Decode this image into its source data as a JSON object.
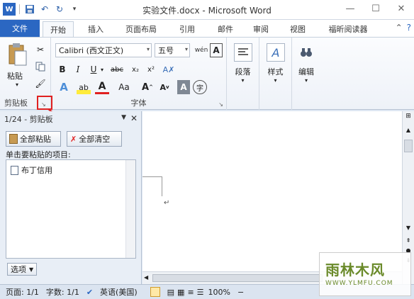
{
  "window": {
    "title": "实验文件.docx - Microsoft Word"
  },
  "tabs": [
    "文件",
    "开始",
    "插入",
    "页面布局",
    "引用",
    "邮件",
    "审阅",
    "视图",
    "福昕阅读器"
  ],
  "ribbon": {
    "clipboard": {
      "paste_label": "粘贴",
      "group_label": "剪贴板"
    },
    "font": {
      "font_name": "Calibri (西文正文)",
      "font_size": "五号",
      "group_label": "字体"
    },
    "paragraph": {
      "label": "段落"
    },
    "styles": {
      "label": "样式"
    },
    "editing": {
      "label": "编辑"
    }
  },
  "clipboard_pane": {
    "counter": "1/24 - 剪贴板",
    "paste_all": "全部粘贴",
    "clear_all": "全部清空",
    "hint": "单击要粘贴的项目:",
    "items": [
      "布丁信用"
    ],
    "options": "选项"
  },
  "statusbar": {
    "page": "页面: 1/1",
    "words": "字数: 1/1",
    "language": "英语(美国)",
    "zoom": "100%"
  },
  "watermark": {
    "name": "雨林木风",
    "url": "WWW.YLMFU.COM"
  },
  "colors": {
    "file_tab": "#2b67c2",
    "accent_red": "#e02020"
  }
}
